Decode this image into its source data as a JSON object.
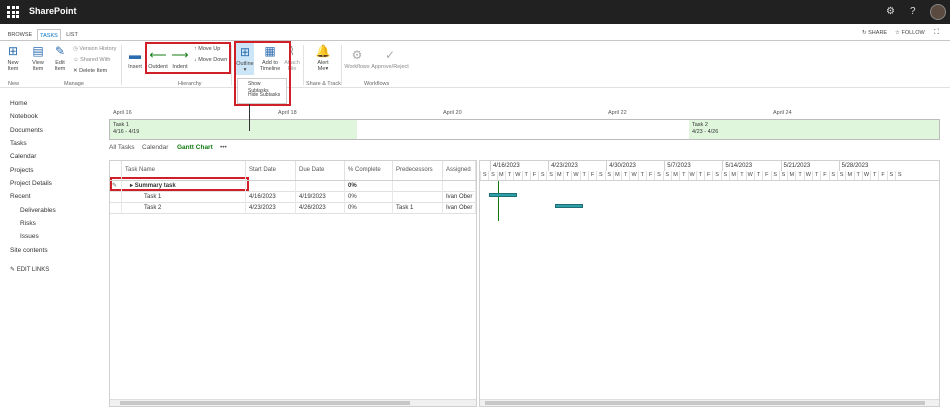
{
  "suite": {
    "brand": "SharePoint",
    "settings_icon": "gear-icon",
    "help_icon": "question-icon"
  },
  "ribbon_tabs": [
    {
      "label": "BROWSE"
    },
    {
      "label": "TASKS"
    },
    {
      "label": "LIST"
    }
  ],
  "ribbon_actions": {
    "share": "SHARE",
    "follow": "FOLLOW"
  },
  "ribbon": {
    "new_item": "New Item",
    "view_item": "View Item",
    "edit_item": "Edit Item",
    "version_history": "Version History",
    "shared_with": "Shared With",
    "delete_item": "Delete Item",
    "insert": "Insert",
    "outdent": "Outdent",
    "indent": "Indent",
    "move_up": "Move Up",
    "move_down": "Move Down",
    "outline": "Outline",
    "add_to_timeline": "Add to Timeline",
    "attach_file": "Attach File",
    "alert_me": "Alert Me",
    "workflows": "Workflows",
    "approve_reject": "Approve/Reject",
    "groups": {
      "new": "New",
      "manage": "Manage",
      "hierarchy": "Hierarchy",
      "share_track": "Share & Track",
      "workflows": "Workflows"
    },
    "outline_menu": [
      "Show Subtasks",
      "Hide Subtasks"
    ]
  },
  "left_nav": [
    {
      "label": "Home",
      "indent": false
    },
    {
      "label": "Notebook",
      "indent": false
    },
    {
      "label": "Documents",
      "indent": false
    },
    {
      "label": "Tasks",
      "indent": false
    },
    {
      "label": "Calendar",
      "indent": false
    },
    {
      "label": "Projects",
      "indent": false
    },
    {
      "label": "Project Details",
      "indent": false
    },
    {
      "label": "Recent",
      "indent": false
    },
    {
      "label": "Deliverables",
      "indent": true
    },
    {
      "label": "Risks",
      "indent": true
    },
    {
      "label": "Issues",
      "indent": true
    },
    {
      "label": "Site contents",
      "indent": false
    },
    {
      "label": "EDIT LINKS",
      "indent": false
    }
  ],
  "timeline": {
    "dates": [
      "April 16",
      "April 18",
      "April 20",
      "April 22",
      "April 24"
    ],
    "tasks": [
      {
        "name": "Task 1",
        "range": "4/16 - 4/19"
      },
      {
        "name": "Task 2",
        "range": "4/23 - 4/26"
      }
    ]
  },
  "views": [
    {
      "label": "All Tasks"
    },
    {
      "label": "Calendar"
    },
    {
      "label": "Gantt Chart"
    },
    {
      "label": "•••"
    }
  ],
  "grid": {
    "columns": [
      "Task Name",
      "Start Date",
      "Due Date",
      "% Complete",
      "Predecessors",
      "Assigned"
    ],
    "rows": [
      {
        "name": "Summary task",
        "start": "",
        "due": "",
        "pct": "0%",
        "pred": "",
        "assigned": ""
      },
      {
        "name": "Task 1",
        "start": "4/16/2023",
        "due": "4/19/2023",
        "pct": "0%",
        "pred": "",
        "assigned": "Ivan Ober"
      },
      {
        "name": "Task 2",
        "start": "4/23/2023",
        "due": "4/26/2023",
        "pct": "0%",
        "pred": "Task 1",
        "assigned": "Ivan Ober"
      }
    ]
  },
  "gantt": {
    "weeks": [
      "4/16/2023",
      "4/23/2023",
      "4/30/2023",
      "5/7/2023",
      "5/14/2023",
      "5/21/2023",
      "5/28/2023"
    ],
    "day_letters": [
      "S",
      "S",
      "M",
      "T",
      "W",
      "T",
      "F"
    ],
    "bar_color": "#2e9fa8"
  }
}
